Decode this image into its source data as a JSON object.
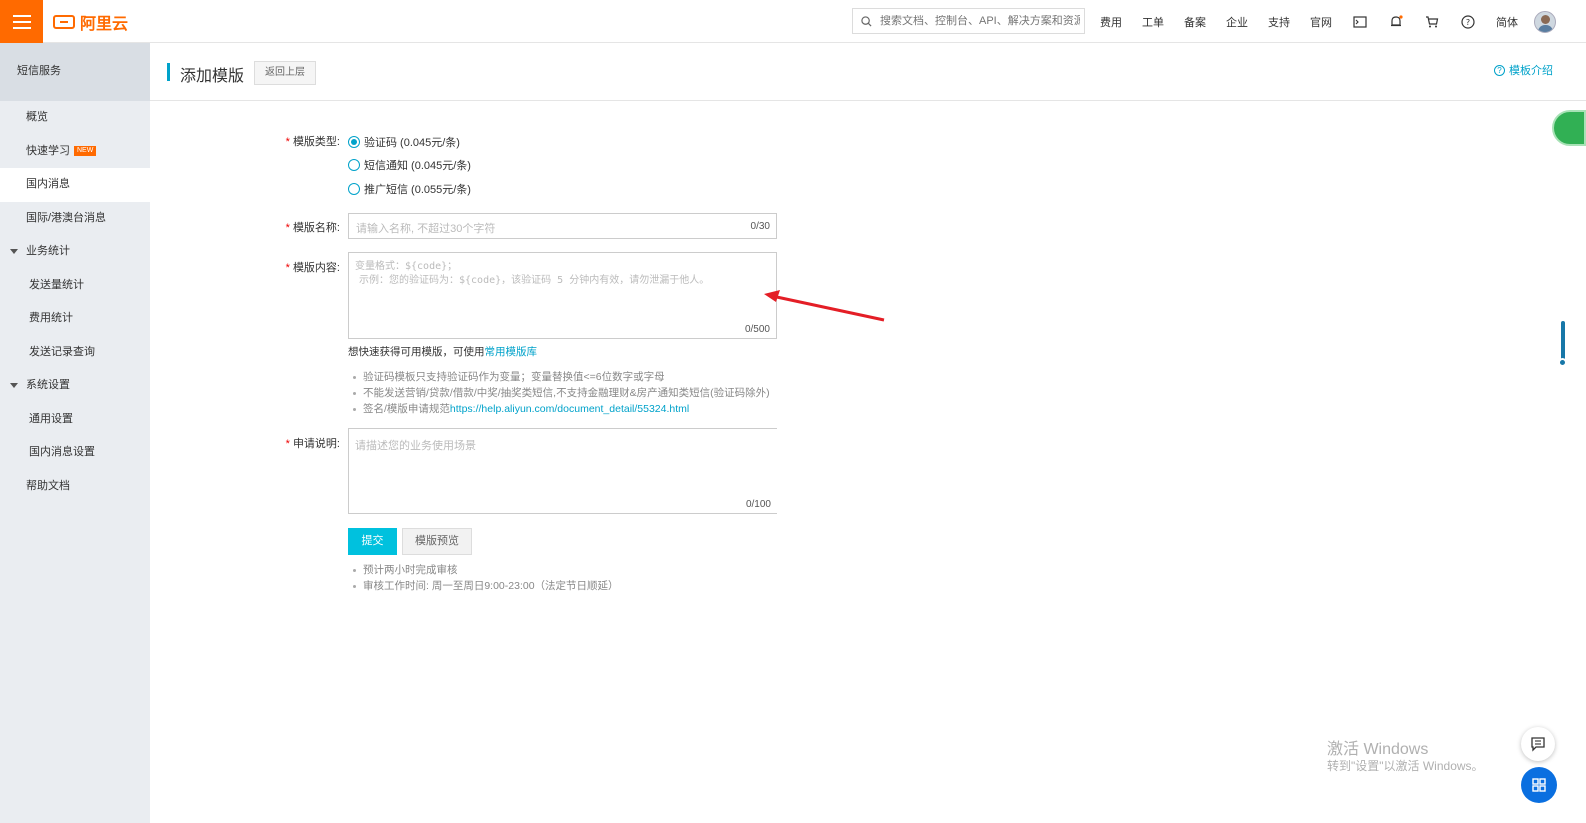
{
  "topbar": {
    "logo_text": "阿里云",
    "search_placeholder": "搜索文档、控制台、API、解决方案和资源",
    "nav_items": [
      "费用",
      "工单",
      "备案",
      "企业",
      "支持",
      "官网"
    ],
    "lang": "简体",
    "accent": "#ff6a00"
  },
  "sidebar": {
    "title": "短信服务",
    "items": [
      {
        "label": "概览"
      },
      {
        "label": "快速学习",
        "badge": "NEW"
      },
      {
        "label": "国内消息"
      },
      {
        "label": "国际/港澳台消息"
      },
      {
        "label": "业务统计"
      },
      {
        "label": "发送量统计"
      },
      {
        "label": "费用统计"
      },
      {
        "label": "发送记录查询"
      },
      {
        "label": "系统设置"
      },
      {
        "label": "通用设置"
      },
      {
        "label": "国内消息设置"
      },
      {
        "label": "帮助文档"
      }
    ]
  },
  "header": {
    "title": "添加模版",
    "back_label": "返回上层",
    "help_label": "模板介绍"
  },
  "form": {
    "type_label": "模版类型:",
    "type_options": [
      {
        "label": "验证码 (0.045元/条)",
        "checked": true
      },
      {
        "label": "短信通知 (0.045元/条)",
        "checked": false
      },
      {
        "label": "推广短信 (0.055元/条)",
        "checked": false
      }
    ],
    "name_label": "模版名称:",
    "name_placeholder": "请输入名称, 不超过30个字符",
    "name_counter": "0/30",
    "content_label": "模版内容:",
    "content_placeholder_line1": "变量格式：${code}；",
    "content_placeholder_line2": "示例：您的验证码为：${code}，该验证码 5 分钟内有效，请勿泄漏于他人。",
    "content_counter": "0/500",
    "library_hint_prefix": "想快速获得可用模版，可使用",
    "library_link": "常用模版库",
    "rules": [
      "验证码模板只支持验证码作为变量；变量替换值<=6位数字或字母",
      "不能发送营销/贷款/借款/中奖/抽奖类短信,不支持金融理财&房产通知类短信(验证码除外)",
      "签名/模版申请规范"
    ],
    "rules_link": "https://help.aliyun.com/document_detail/55324.html",
    "reason_label": "申请说明:",
    "reason_placeholder": "请描述您的业务使用场景",
    "reason_counter": "0/100",
    "submit_label": "提交",
    "preview_label": "模版预览",
    "notes": [
      "预计两小时完成审核",
      "审核工作时间: 周一至周日9:00-23:00（法定节日顺延）"
    ]
  },
  "watermark": {
    "line1": "激活 Windows",
    "line2": "转到\"设置\"以激活 Windows。"
  }
}
